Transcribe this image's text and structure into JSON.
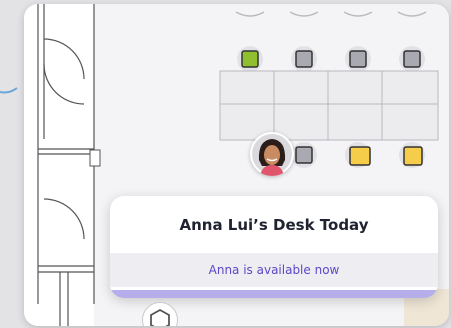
{
  "popup": {
    "title": "Anna Lui’s Desk Today",
    "status": "Anna is available now"
  },
  "colors": {
    "accent": "#5b48c7",
    "desk_booked_green": "#8fbf2f",
    "desk_available_yellow": "#f5cd4a",
    "desk_unavailable_gray": "#a9a9b1"
  },
  "icons": {
    "avatar": "anna-avatar",
    "bottom": "navigation-icon"
  }
}
